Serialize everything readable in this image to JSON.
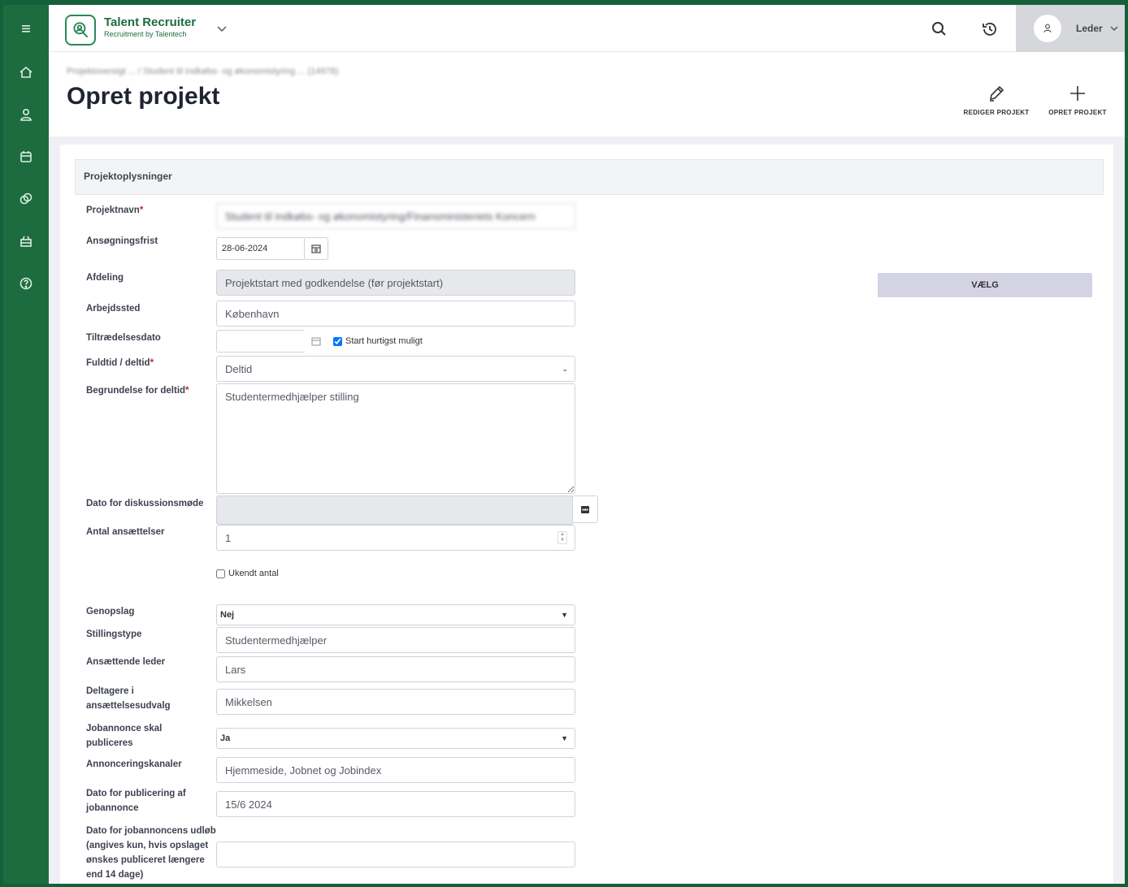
{
  "app": {
    "brand_name": "Talent Recruiter",
    "brand_sub": "Recruitment by Talentech",
    "user_name": "Leder"
  },
  "sidebar": {
    "items": [
      {
        "icon": "menu-icon"
      },
      {
        "icon": "home-icon"
      },
      {
        "icon": "user-icon"
      },
      {
        "icon": "calendar-icon"
      },
      {
        "icon": "copy-icon"
      },
      {
        "icon": "inbox-icon"
      },
      {
        "icon": "help-icon"
      }
    ]
  },
  "header": {
    "breadcrumb": "Projektoversigt ... / Student til indkøbs- og økonomistyring ... (14978)",
    "title": "Opret projekt",
    "actions": {
      "edit_label": "REDIGER PROJEKT",
      "create_label": "OPRET PROJEKT"
    }
  },
  "form": {
    "section_title": "Projektoplysninger",
    "project_name": {
      "label": "Projektnavn",
      "value": "Student til indkøbs- og økonomistyring/Finansministeriets Koncern"
    },
    "deadline": {
      "label": "Ansøgningsfrist",
      "value": "28-06-2024"
    },
    "department": {
      "label": "Afdeling",
      "value": "Projektstart med godkendelse (før projektstart)",
      "button_label": "VÆLG"
    },
    "workplace": {
      "label": "Arbejdssted",
      "value": "København"
    },
    "start_date": {
      "label": "Tiltrædelsesdato",
      "value": "",
      "asap_label": "Start hurtigst muligt",
      "asap_checked": true
    },
    "time_type": {
      "label": "Fuldtid / deltid",
      "value": "Deltid"
    },
    "part_time_reason": {
      "label": "Begrundelse for deltid",
      "value": "Studentermedhjælper stilling"
    },
    "meeting_date": {
      "label": "Dato for diskussionsmøde",
      "value": ""
    },
    "hires": {
      "label": "Antal ansættelser",
      "value": "1",
      "unknown_label": "Ukendt antal",
      "unknown_checked": false
    },
    "repost": {
      "label": "Genopslag",
      "value": "Nej"
    },
    "position_type": {
      "label": "Stillingstype",
      "value": "Studentermedhjælper"
    },
    "hiring_manager": {
      "label": "Ansættende leder",
      "value": "Lars"
    },
    "committee": {
      "label": "Deltagere i ansættelsesudvalg",
      "value": "Mikkelsen"
    },
    "publish_ad": {
      "label": "Jobannonce skal publiceres",
      "value": "Ja"
    },
    "channels": {
      "label": "Annonceringskanaler",
      "value": "Hjemmeside, Jobnet og Jobindex"
    },
    "publish_date": {
      "label": "Dato for publicering af jobannonce",
      "value": "15/6 2024"
    },
    "expiry_date": {
      "label": "Dato for jobannoncens udløb (angives kun, hvis opslaget ønskes publiceret længere end 14 dage)",
      "value": ""
    }
  }
}
